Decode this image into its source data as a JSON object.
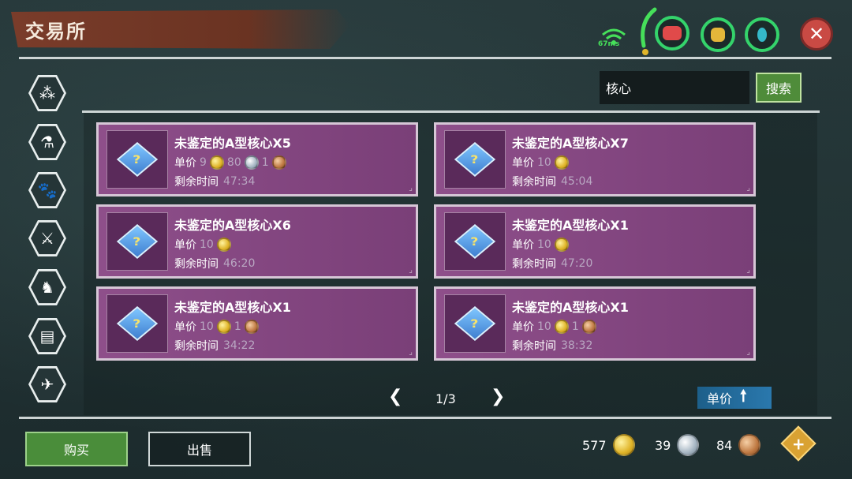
{
  "header": {
    "title": "交易所",
    "ping": "67ms",
    "close_glyph": "✕",
    "hud": [
      {
        "name": "health-icon",
        "color": "#e04a4a"
      },
      {
        "name": "stamina-icon",
        "color": "#e4b73a"
      },
      {
        "name": "water-icon",
        "color": "#35b8c9"
      }
    ]
  },
  "sidebar": {
    "items": [
      {
        "name": "resources-icon",
        "glyph": "⁂"
      },
      {
        "name": "potion-icon",
        "glyph": "⚗"
      },
      {
        "name": "paw-icon",
        "glyph": "🐾"
      },
      {
        "name": "weapon-icon",
        "glyph": "⚔"
      },
      {
        "name": "mount-icon",
        "glyph": "♞"
      },
      {
        "name": "furniture-icon",
        "glyph": "▤"
      },
      {
        "name": "misc-icon",
        "glyph": "✈"
      }
    ]
  },
  "search": {
    "value": "核心",
    "button_label": "搜索"
  },
  "labels": {
    "unit_price": "单价",
    "remaining_time": "剩余时间"
  },
  "listings": [
    {
      "name": "未鉴定的A型核心X5",
      "gold": "9",
      "silver": "80",
      "bronze": "1",
      "time": "47:34"
    },
    {
      "name": "未鉴定的A型核心X7",
      "gold": "10",
      "silver": "",
      "bronze": "",
      "time": "45:04"
    },
    {
      "name": "未鉴定的A型核心X6",
      "gold": "10",
      "silver": "",
      "bronze": "",
      "time": "46:20"
    },
    {
      "name": "未鉴定的A型核心X1",
      "gold": "10",
      "silver": "",
      "bronze": "",
      "time": "47:20"
    },
    {
      "name": "未鉴定的A型核心X1",
      "gold": "10",
      "silver": "",
      "bronze": "1",
      "time": "34:22"
    },
    {
      "name": "未鉴定的A型核心X1",
      "gold": "10",
      "silver": "",
      "bronze": "1",
      "time": "38:32"
    }
  ],
  "pagination": {
    "prev": "❮",
    "next": "❯",
    "page": "1/3",
    "sort_label": "单价",
    "sort_arrow": "🠕"
  },
  "footer": {
    "buy_label": "购买",
    "sell_label": "出售",
    "gold": "577",
    "silver": "39",
    "bronze": "84",
    "plus": "+"
  }
}
